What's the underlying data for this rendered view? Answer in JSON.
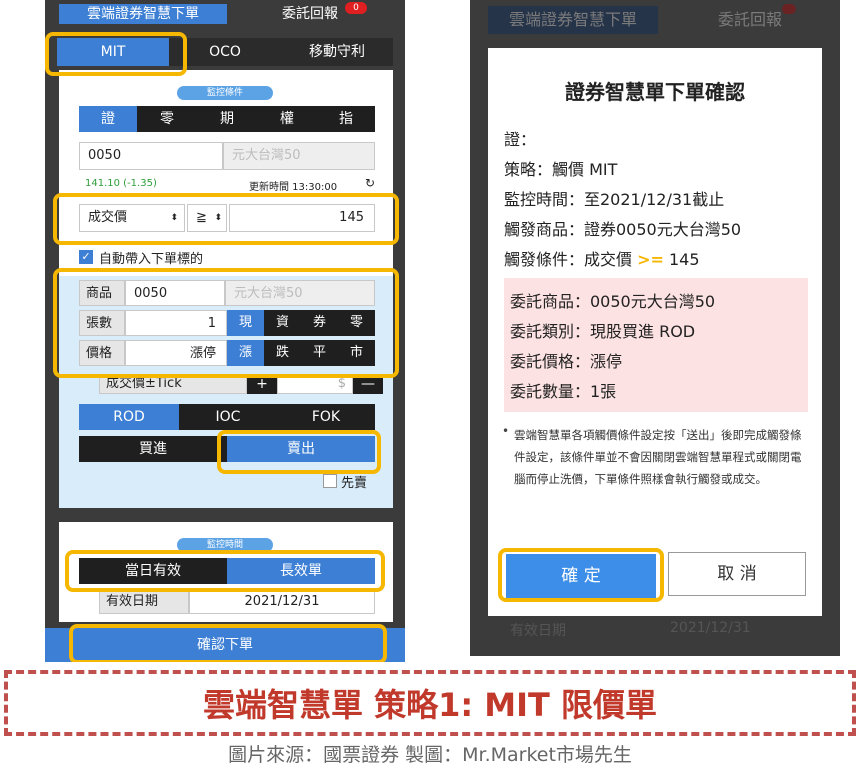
{
  "colors": {
    "brand_blue": "#3d7fd4",
    "highlight": "#f6b700",
    "caption_red": "#c0392b"
  },
  "left": {
    "top_tabs": {
      "active": "雲端證券智慧下單",
      "other": "委託回報",
      "badge": "0"
    },
    "modes": [
      "MIT",
      "OCO",
      "移動守利"
    ],
    "monitor_pill": "監控條件",
    "product_types": [
      "證",
      "零",
      "期",
      "權",
      "指"
    ],
    "symbol_value": "0050",
    "symbol_name": "元大台灣50",
    "quote": "141.10 (-1.35)",
    "update_time": "更新時間 13:30:00",
    "condition": {
      "field": "成交價",
      "op": "≧",
      "price": "145"
    },
    "auto_fill_label": "自動帶入下單標的",
    "order": {
      "product_label": "商品",
      "product_value": "0050",
      "product_name": "元大台灣50",
      "qty_label": "張數",
      "qty_value": "1",
      "qty_options": [
        "現",
        "資",
        "券",
        "零"
      ],
      "price_label": "價格",
      "price_value": "漲停",
      "price_options": [
        "漲",
        "跌",
        "平",
        "市"
      ],
      "tick_label": "成交價±Tick",
      "tick_plus": "+",
      "tick_unit": "$",
      "tick_minus": "—"
    },
    "tif": [
      "ROD",
      "IOC",
      "FOK"
    ],
    "sides": [
      "買進",
      "賣出"
    ],
    "first_sell": "先賣",
    "time_pill": "監控時間",
    "validity": [
      "當日有效",
      "長效單"
    ],
    "valid_date_label": "有效日期",
    "valid_date_value": "2021/12/31",
    "confirm_button": "確認下單"
  },
  "right": {
    "top_tabs": {
      "active": "雲端證券智慧下單",
      "other": "委託回報"
    },
    "dialog": {
      "title": "證券智慧單下單確認",
      "lines": [
        "證：",
        "策略：觸價 MIT",
        "監控時間：至2021/12/31截止",
        "觸發商品：證券0050元大台灣50"
      ],
      "trigger_prefix": "觸發條件：成交價 ",
      "trigger_op": ">=",
      "trigger_value": " 145",
      "order_lines": [
        "委託商品：0050元大台灣50",
        "委託類別：現股買進 ROD",
        "委託價格：漲停",
        "委託數量：1張"
      ],
      "note": "雲端智慧單各項觸價條件設定按「送出」後即完成觸發條件設定，該條件單並不會因關閉雲端智慧單程式或關閉電腦而停止洗價，下單條件照樣會執行觸發或成交。",
      "ok": "確 定",
      "cancel": "取 消"
    },
    "behind": {
      "label": "有效日期",
      "value": "2021/12/31"
    }
  },
  "caption": "雲端智慧單 策略1: MIT 限價單",
  "source": "圖片來源：國票證券 製圖：Mr.Market市場先生"
}
